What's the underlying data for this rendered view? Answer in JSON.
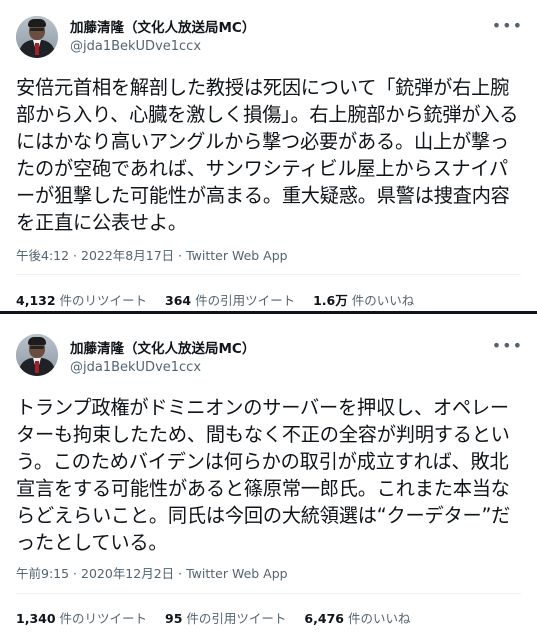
{
  "tweets": [
    {
      "author": {
        "display_name": "加藤清隆（文化人放送局MC）",
        "handle": "@jda1BekUDve1ccx"
      },
      "text": "安倍元首相を解剖した教授は死因について「銃弾が右上腕部から入り、心臓を激しく損傷」。右上腕部から銃弾が入るにはかなり高いアングルから撃つ必要がある。山上が撃ったのが空砲であれば、サンワシティビル屋上からスナイパーが狙撃した可能性が高まる。重大疑惑。県警は捜査内容を正直に公表せよ。",
      "timestamp": "午後4:12 · 2022年8月17日 · Twitter Web App",
      "retweets": {
        "count": "4,132",
        "label": "件のリツイート"
      },
      "quotes": {
        "count": "364",
        "label": "件の引用ツイート"
      },
      "likes": {
        "count": "1.6万",
        "label": "件のいいね"
      },
      "more_icon": "more-horizontal-icon"
    },
    {
      "author": {
        "display_name": "加藤清隆（文化人放送局MC）",
        "handle": "@jda1BekUDve1ccx"
      },
      "text": "トランプ政権がドミニオンのサーバーを押収し、オペレーターも拘束したため、間もなく不正の全容が判明するという。このためバイデンは何らかの取引が成立すれば、敗北宣言をする可能性があると篠原常一郎氏。これまた本当ならどえらいこと。同氏は今回の大統領選は“クーデター”だったとしている。",
      "timestamp": "午前9:15 · 2020年12月2日 · Twitter Web App",
      "retweets": {
        "count": "1,340",
        "label": "件のリツイート"
      },
      "quotes": {
        "count": "95",
        "label": "件の引用ツイート"
      },
      "likes": {
        "count": "6,476",
        "label": "件のいいね"
      },
      "more_icon": "more-horizontal-icon"
    }
  ]
}
